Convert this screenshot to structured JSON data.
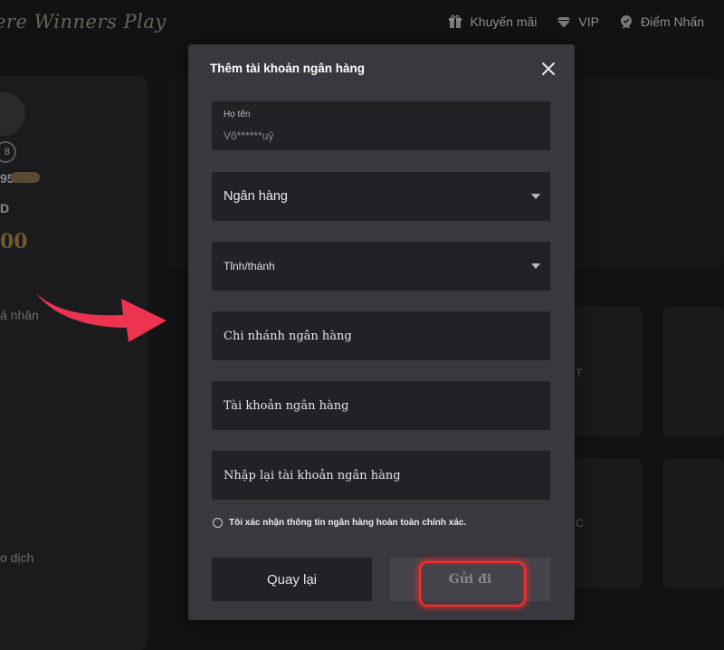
{
  "background": {
    "logo_text": "ere Winners Play",
    "nav": [
      {
        "label": "Khuyến mãi",
        "icon": "gift-icon"
      },
      {
        "label": "VIP",
        "icon": "diamond-icon"
      },
      {
        "label": "Điểm Nhấn",
        "icon": "medal-icon"
      }
    ],
    "sidebar": {
      "avatar_badge": "8",
      "frag_id": "95",
      "frag_d": "D",
      "frag_balance": "00",
      "frag_profile": "ả nhân",
      "frag_history": "o dịch"
    },
    "frag_t": "T",
    "frag_c": "C"
  },
  "modal": {
    "title": "Thêm tài khoản ngân hàng",
    "fullname": {
      "label": "Họ tên",
      "value": "Võ******uỷ"
    },
    "bank_select": {
      "placeholder": "Ngân hàng"
    },
    "province_select": {
      "placeholder": "Tỉnh/thành"
    },
    "branch_field": {
      "placeholder": "Chi nhánh ngân hàng"
    },
    "account_field": {
      "placeholder": "Tài khoản ngân hàng"
    },
    "account_confirm_field": {
      "placeholder": "Nhập lại tài khoản ngân hàng"
    },
    "confirm_text": "Tôi xác nhận thông tin ngân hàng hoàn toàn chính xác.",
    "back_label": "Quay lại",
    "send_label": "Gửi đi"
  },
  "colors": {
    "modal_bg": "#38383e",
    "field_bg": "#212126",
    "highlight": "#ff2b2b",
    "arrow": "#ee3350"
  }
}
